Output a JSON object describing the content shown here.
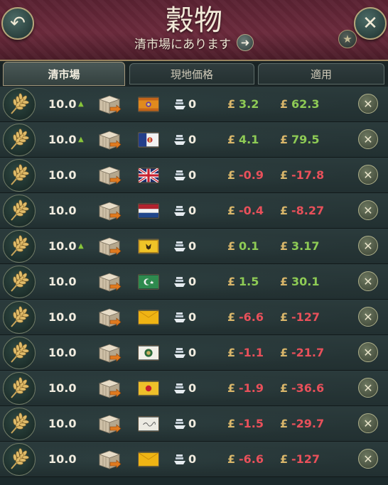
{
  "header": {
    "title": "穀物",
    "subtitle": "清市場にあります",
    "back_icon": "back-arrow-icon",
    "close_icon": "close-icon",
    "star_icon": "star-icon",
    "goto_icon": "arrow-right-icon"
  },
  "tabs": [
    {
      "label": "清市場",
      "active": true
    },
    {
      "label": "現地価格",
      "active": false
    },
    {
      "label": "適用",
      "active": false
    }
  ],
  "rows": [
    {
      "amount": "10.0",
      "trend_up": true,
      "flag": "orange-banner",
      "ships": "0",
      "price_delta": "3.2",
      "total": "62.3",
      "sign": "pos"
    },
    {
      "amount": "10.0",
      "trend_up": true,
      "flag": "blue-white-crest",
      "ships": "0",
      "price_delta": "4.1",
      "total": "79.5",
      "sign": "pos"
    },
    {
      "amount": "10.0",
      "trend_up": false,
      "flag": "union-jack",
      "ships": "0",
      "price_delta": "-0.9",
      "total": "-17.8",
      "sign": "neg"
    },
    {
      "amount": "10.0",
      "trend_up": false,
      "flag": "red-white-blue",
      "ships": "0",
      "price_delta": "-0.4",
      "total": "-8.27",
      "sign": "neg"
    },
    {
      "amount": "10.0",
      "trend_up": true,
      "flag": "yellow-eagle",
      "ships": "0",
      "price_delta": "0.1",
      "total": "3.17",
      "sign": "pos"
    },
    {
      "amount": "10.0",
      "trend_up": false,
      "flag": "green-crescent",
      "ships": "0",
      "price_delta": "1.5",
      "total": "30.1",
      "sign": "pos"
    },
    {
      "amount": "10.0",
      "trend_up": false,
      "flag": "yellow-plain",
      "ships": "0",
      "price_delta": "-6.6",
      "total": "-127",
      "sign": "neg"
    },
    {
      "amount": "10.0",
      "trend_up": false,
      "flag": "white-green-emblem",
      "ships": "0",
      "price_delta": "-1.1",
      "total": "-21.7",
      "sign": "neg"
    },
    {
      "amount": "10.0",
      "trend_up": false,
      "flag": "yellow-red-sun",
      "ships": "0",
      "price_delta": "-1.9",
      "total": "-36.6",
      "sign": "neg"
    },
    {
      "amount": "10.0",
      "trend_up": false,
      "flag": "white-script",
      "ships": "0",
      "price_delta": "-1.5",
      "total": "-29.7",
      "sign": "neg"
    },
    {
      "amount": "10.0",
      "trend_up": false,
      "flag": "yellow-plain",
      "ships": "0",
      "price_delta": "-6.6",
      "total": "-127",
      "sign": "neg"
    }
  ],
  "currency_symbol": "£",
  "colors": {
    "positive": "#8ecb55",
    "negative": "#e8505a",
    "accent": "#d9b66a"
  }
}
